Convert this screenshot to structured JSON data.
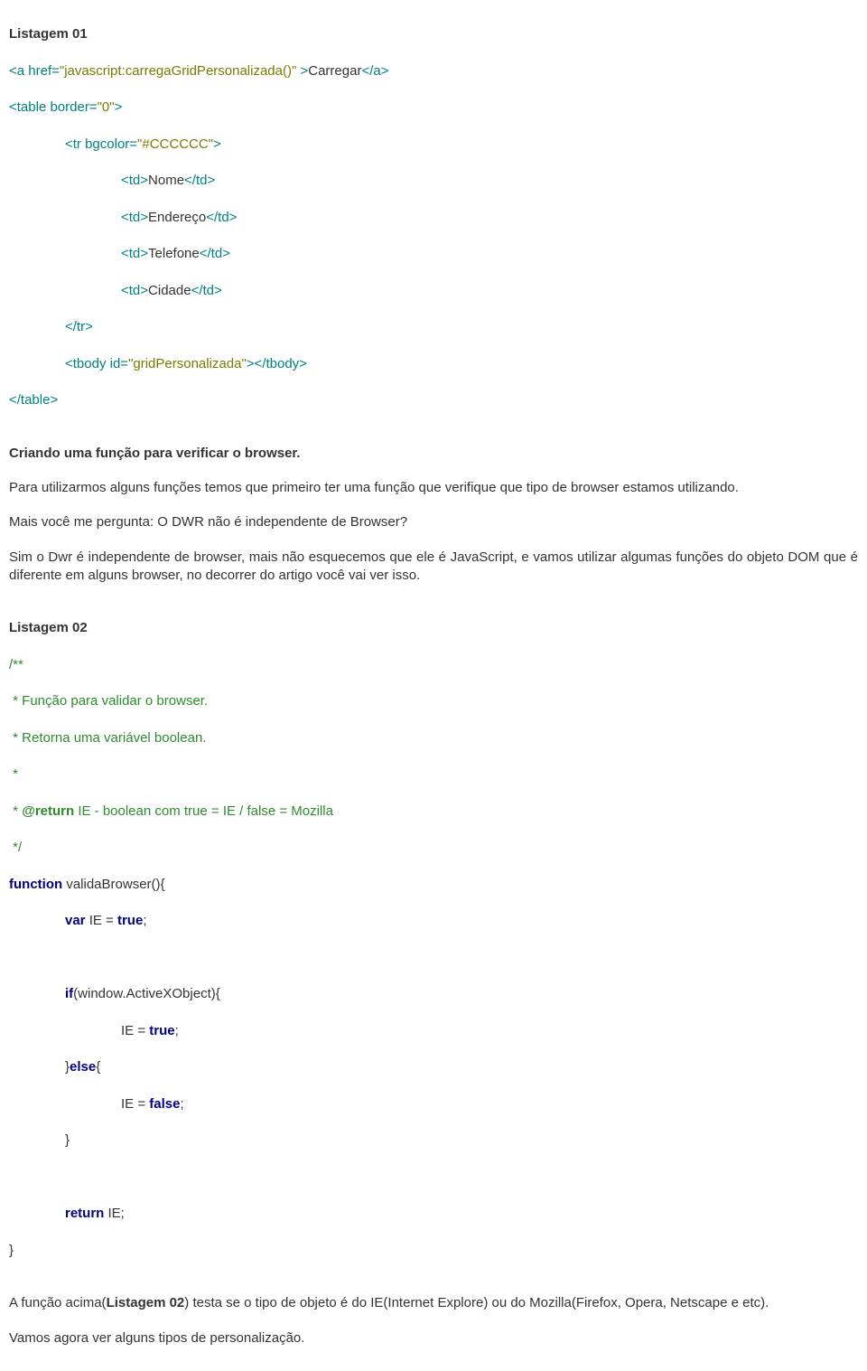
{
  "listing1": {
    "title": "Listagem 01",
    "l1_a": "<a href=",
    "l1_b": "\"javascript:carregaGridPersonalizada()\"",
    "l1_c": " >",
    "l1_d": "Carregar",
    "l1_e": "</a>",
    "l2_a": "<table border=",
    "l2_b": "\"0\"",
    "l2_c": ">",
    "l3_a": "<tr bgcolor=",
    "l3_b": "\"#CCCCCC\"",
    "l3_c": ">",
    "l4_a": "<td>",
    "l4_b": "Nome",
    "l4_c": "</td>",
    "l5_a": "<td>",
    "l5_b": "Endereço",
    "l5_c": "</td>",
    "l6_a": "<td>",
    "l6_b": "Telefone",
    "l6_c": "</td>",
    "l7_a": "<td>",
    "l7_b": "Cidade",
    "l7_c": "</td>",
    "l8": "</tr>",
    "l9_a": "<tbody id=",
    "l9_b": "\"gridPersonalizada\"",
    "l9_c": "></tbody>",
    "l10": "</table>"
  },
  "section1_heading": "Criando uma função para verificar o browser.",
  "para1": "Para utilizarmos alguns funções temos que primeiro ter uma função que verifique que tipo de browser estamos utilizando.",
  "para2": "Mais você me pergunta: O DWR não é independente de Browser?",
  "para3": "Sim o Dwr é independente de browser, mais não esquecemos que ele é JavaScript, e vamos utilizar algumas funções do objeto DOM que é diferente em alguns browser, no decorrer do artigo você vai ver isso.",
  "listing2": {
    "title": "Listagem 02",
    "c1": "/**",
    "c2": " * Função para validar o browser.",
    "c3": " * Retorna uma variável boolean.",
    "c4": " *",
    "c5_a": " * ",
    "c5_b": "@return",
    "c5_c": " IE - boolean com true = IE / false = Mozilla",
    "c6": " */",
    "fn_kw": "function",
    "fn_name": " validaBrowser(){",
    "var_kw": "var",
    "var_rest": " IE = ",
    "true_kw": "true",
    "semicolon": ";",
    "if_kw": "if",
    "if_cond": "(window.ActiveXObject){",
    "assign_true": "IE = ",
    "close_else_a": "}",
    "else_kw": "else",
    "close_else_b": "{",
    "false_kw": "false",
    "assign_false": "IE = ",
    "close_brace": "}",
    "return_kw": "return",
    "return_rest": " IE;",
    "final_brace": "}"
  },
  "para4_a": "A função acima(",
  "para4_b": "Listagem 02",
  "para4_c": ") testa se o tipo de objeto é do IE(Internet Explore) ou do Mozilla(Firefox, Opera, Netscape e etc).",
  "para5": "Vamos agora ver alguns tipos de personalização."
}
